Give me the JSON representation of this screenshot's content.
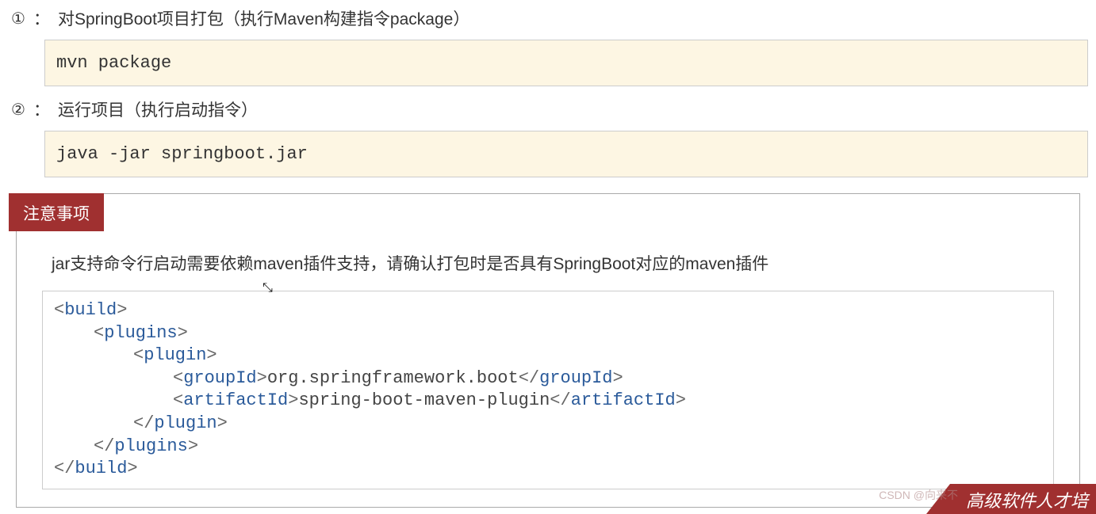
{
  "step1": {
    "num": "①",
    "colon": "：",
    "text": "对SpringBoot项目打包（执行Maven构建指令package）",
    "code": "mvn package"
  },
  "step2": {
    "num": "②",
    "colon": "：",
    "text": "运行项目（执行启动指令）",
    "code": "java -jar springboot.jar"
  },
  "notice": {
    "badge": "注意事项",
    "text": "jar支持命令行启动需要依赖maven插件支持，请确认打包时是否具有SpringBoot对应的maven插件",
    "xml": {
      "build_open_lt": "<",
      "build": "build",
      "gt": ">",
      "plugins": "plugins",
      "plugin": "plugin",
      "groupId": "groupId",
      "groupId_val": "org.springframework.boot",
      "artifactId": "artifactId",
      "artifactId_val": "spring-boot-maven-plugin",
      "lt": "<",
      "lts": "</"
    }
  },
  "cursor_glyph": "⤡",
  "watermark": {
    "csdn": "CSDN @向来不",
    "banner": "高级软件人才培"
  }
}
